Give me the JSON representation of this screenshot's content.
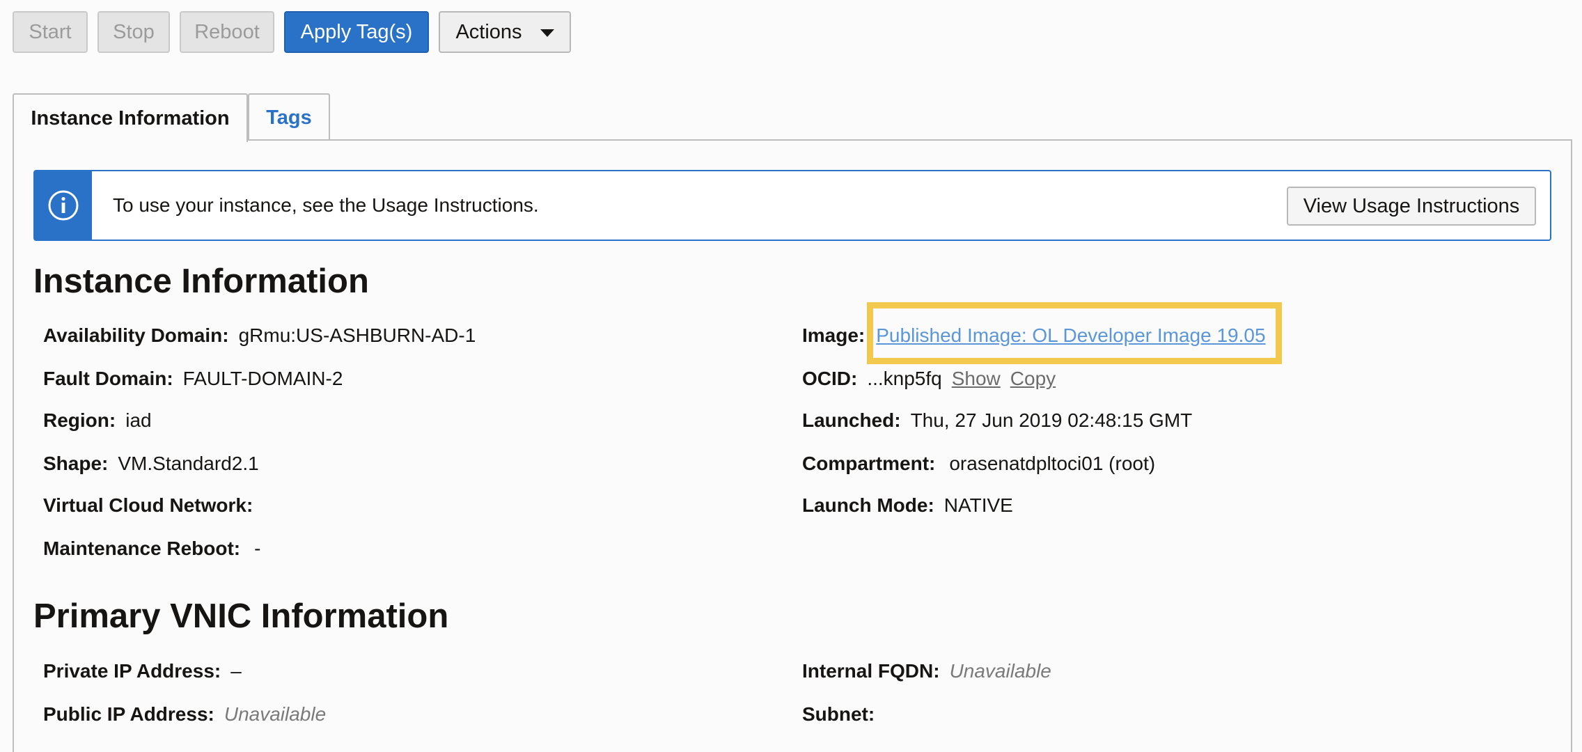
{
  "toolbar": {
    "start": "Start",
    "stop": "Stop",
    "reboot": "Reboot",
    "apply_tags": "Apply Tag(s)",
    "actions": "Actions"
  },
  "tabs": [
    {
      "label": "Instance Information",
      "active": true
    },
    {
      "label": "Tags",
      "active": false
    }
  ],
  "banner": {
    "text": "To use your instance, see the Usage Instructions.",
    "button": "View Usage Instructions",
    "icon": "info-icon"
  },
  "instance_info": {
    "title": "Instance Information",
    "left": [
      {
        "label": "Availability Domain:",
        "value": "gRmu:US-ASHBURN-AD-1"
      },
      {
        "label": "Fault Domain:",
        "value": "FAULT-DOMAIN-2"
      },
      {
        "label": "Region:",
        "value": "iad"
      },
      {
        "label": "Shape:",
        "value": "VM.Standard2.1"
      },
      {
        "label": "Virtual Cloud Network:",
        "value": ""
      },
      {
        "label": "Maintenance Reboot:",
        "value": "-"
      }
    ],
    "image": {
      "label": "Image:",
      "value": "Published Image: OL Developer Image 19.05"
    },
    "ocid": {
      "label": "OCID:",
      "value": "...knp5fq",
      "show": "Show",
      "copy": "Copy"
    },
    "launched": {
      "label": "Launched:",
      "value": "Thu, 27 Jun 2019 02:48:15 GMT"
    },
    "compartment": {
      "label": "Compartment:",
      "value": "orasenatdpltoci01 (root)"
    },
    "launch_mode": {
      "label": "Launch Mode:",
      "value": "NATIVE"
    }
  },
  "vnic_info": {
    "title": "Primary VNIC Information",
    "private_ip": {
      "label": "Private IP Address:",
      "value": "–"
    },
    "public_ip": {
      "label": "Public IP Address:",
      "value": "Unavailable"
    },
    "internal_fqdn": {
      "label": "Internal FQDN:",
      "value": "Unavailable"
    },
    "subnet": {
      "label": "Subnet:",
      "value": ""
    }
  },
  "colors": {
    "primary": "#2a72c8",
    "highlight": "#f2c94c",
    "link": "#5b97d8"
  }
}
